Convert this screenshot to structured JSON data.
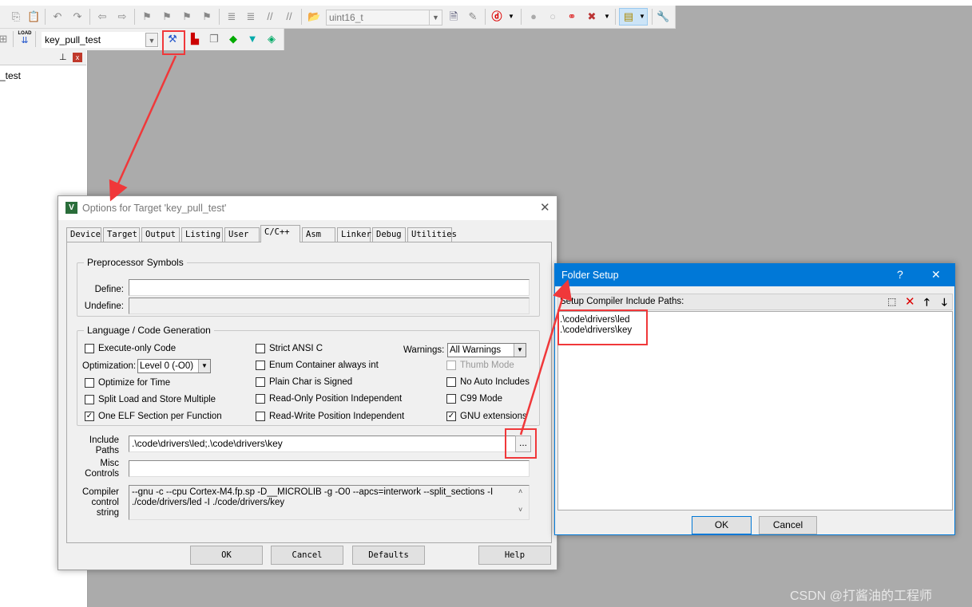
{
  "toolbar1": {
    "type_combo": "uint16_t",
    "icons": [
      "copy-icon",
      "paste-icon",
      "undo-icon",
      "redo-icon",
      "back-icon",
      "forward-icon",
      "bookmark-icon",
      "bookmark-prev-icon",
      "bookmark-next-icon",
      "bookmark-clear-icon",
      "indent-icon",
      "unindent-icon",
      "comment-icon",
      "uncomment-icon",
      "find-in-files-icon",
      "find-icon",
      "debug-session-icon",
      "breakpoint-icon",
      "breakpoint-disable-icon",
      "breakpoint-kill-icon",
      "window-layout-icon",
      "configure-icon"
    ]
  },
  "toolbar2": {
    "load_label": "LOAD",
    "target_combo": "key_pull_test",
    "icons": [
      "options-for-target-icon",
      "manage-project-icon",
      "select-packs-icon",
      "manage-runtime-icon",
      "manage-components-icon"
    ]
  },
  "left_panel": {
    "tree_item": "_test"
  },
  "options_dialog": {
    "title": "Options for Target 'key_pull_test'",
    "tabs": [
      "Device",
      "Target",
      "Output",
      "Listing",
      "User",
      "C/C++",
      "Asm",
      "Linker",
      "Debug",
      "Utilities"
    ],
    "active_tab": "C/C++",
    "preprocessor": {
      "group_label": "Preprocessor Symbols",
      "define_label": "Define:",
      "define_value": "",
      "undefine_label": "Undefine:",
      "undefine_value": ""
    },
    "language": {
      "group_label": "Language / Code Generation",
      "checkboxes": [
        {
          "label": "Execute-only Code",
          "checked": false
        },
        {
          "label": "Optimize for Time",
          "checked": false
        },
        {
          "label": "Split Load and Store Multiple",
          "checked": false
        },
        {
          "label": "One ELF Section per Function",
          "checked": true
        },
        {
          "label": "Strict ANSI C",
          "checked": false
        },
        {
          "label": "Enum Container always int",
          "checked": false
        },
        {
          "label": "Plain Char is Signed",
          "checked": false
        },
        {
          "label": "Read-Only Position Independent",
          "checked": false
        },
        {
          "label": "Read-Write Position Independent",
          "checked": false
        },
        {
          "label": "Thumb Mode",
          "checked": false,
          "disabled": true
        },
        {
          "label": "No Auto Includes",
          "checked": false
        },
        {
          "label": "C99 Mode",
          "checked": false
        },
        {
          "label": "GNU extensions",
          "checked": true
        }
      ],
      "optimization_label": "Optimization:",
      "optimization_value": "Level 0 (-O0)",
      "warnings_label": "Warnings:",
      "warnings_value": "All Warnings"
    },
    "include_label": "Include Paths",
    "include_value": ".\\code\\drivers\\led;.\\code\\drivers\\key",
    "browse_label": "...",
    "misc_label": "Misc Controls",
    "misc_value": "",
    "compiler_label": "Compiler control string",
    "compiler_value": "--gnu -c --cpu Cortex-M4.fp.sp -D__MICROLIB -g -O0 --apcs=interwork --split_sections -I ./code/drivers/led -I ./code/drivers/key",
    "buttons": {
      "ok": "OK",
      "cancel": "Cancel",
      "defaults": "Defaults",
      "help": "Help"
    }
  },
  "folder_dialog": {
    "title": "Folder Setup",
    "help": "?",
    "close": "✕",
    "caption": "Setup Compiler Include Paths:",
    "paths": [
      ".\\code\\drivers\\led",
      ".\\code\\drivers\\key"
    ],
    "ok": "OK",
    "cancel": "Cancel",
    "title_color": "#0078d7"
  },
  "watermark": "CSDN @打酱油的工程师",
  "highlight_color": "#f0383a"
}
